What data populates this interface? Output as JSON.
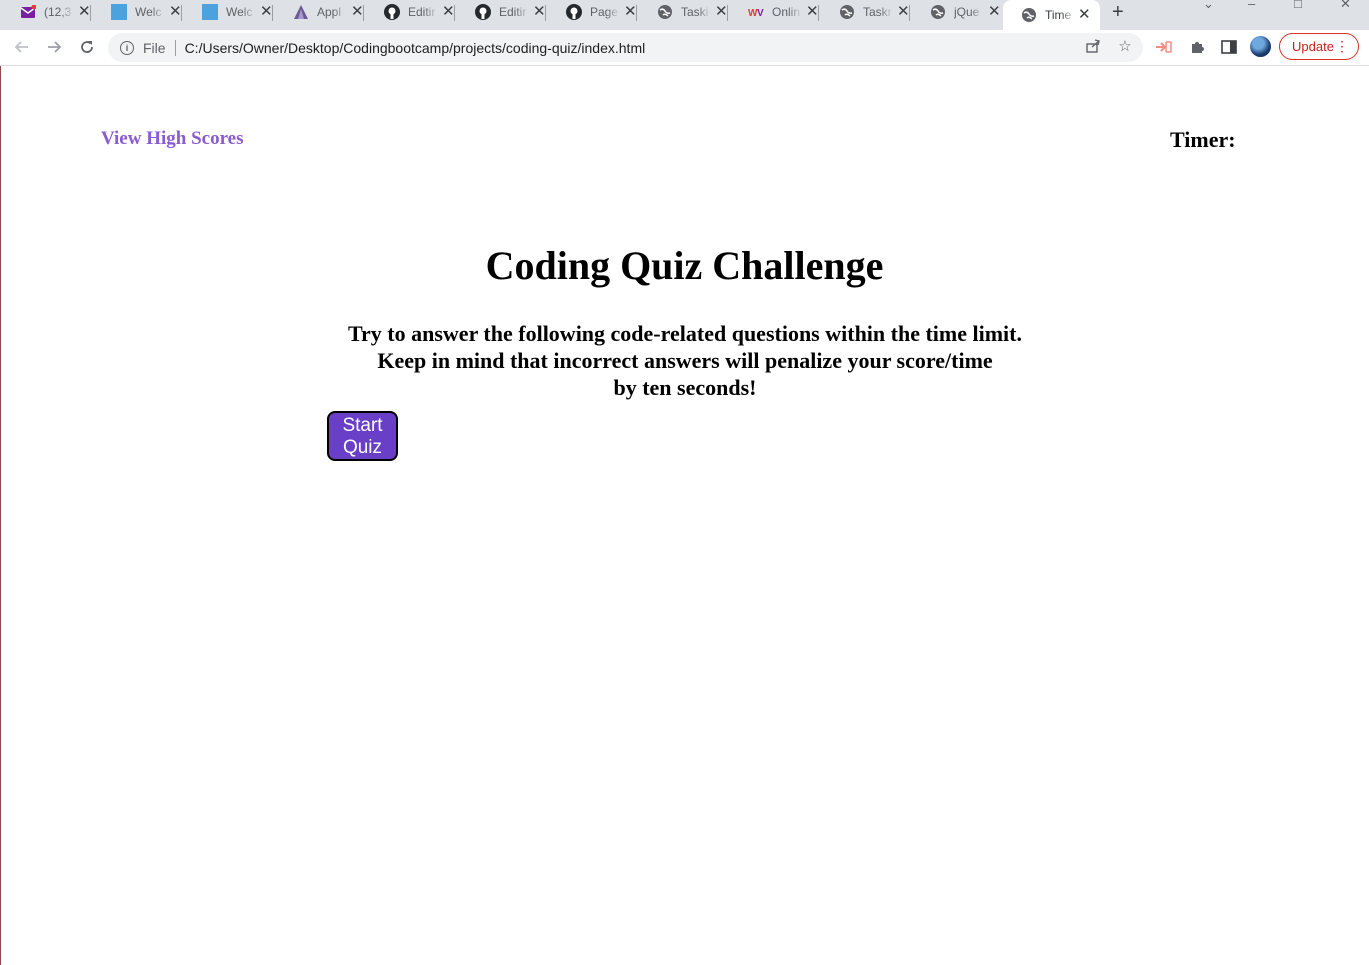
{
  "browser": {
    "tabs": [
      {
        "title": "(12,3",
        "icon": "mail-icon",
        "active": false
      },
      {
        "title": "Welc",
        "icon": "square-icon",
        "active": false
      },
      {
        "title": "Welc",
        "icon": "square-icon",
        "active": false
      },
      {
        "title": "Appl",
        "icon": "triangle-logo-icon",
        "active": false
      },
      {
        "title": "Editir",
        "icon": "github-icon",
        "active": false
      },
      {
        "title": "Editir",
        "icon": "github-icon",
        "active": false
      },
      {
        "title": "Page",
        "icon": "github-icon",
        "active": false
      },
      {
        "title": "Taski",
        "icon": "globe-icon",
        "active": false
      },
      {
        "title": "Onlin",
        "icon": "wv-logo-icon",
        "active": false
      },
      {
        "title": "Taskr",
        "icon": "globe-icon",
        "active": false
      },
      {
        "title": "jQue",
        "icon": "globe-icon",
        "active": false
      },
      {
        "title": "Time",
        "icon": "globe-icon",
        "active": true
      }
    ],
    "address": {
      "scheme_label": "File",
      "url": "C:/Users/Owner/Desktop/Codingbootcamp/projects/coding-quiz/index.html"
    },
    "update_label": "Update"
  },
  "page": {
    "high_scores_link": "View High Scores",
    "timer_label": "Timer:",
    "title": "Coding Quiz Challenge",
    "instructions": {
      "line1": "Try to answer the following code-related questions within the time limit.",
      "line2": "Keep in mind that incorrect answers will penalize your score/time",
      "line3": "by ten seconds!"
    },
    "start_button": {
      "line1": "Start",
      "line2": "Quiz"
    }
  },
  "colors": {
    "link": "#8a5cd0",
    "button_bg": "#6a3fc8",
    "update_red": "#d93025"
  }
}
